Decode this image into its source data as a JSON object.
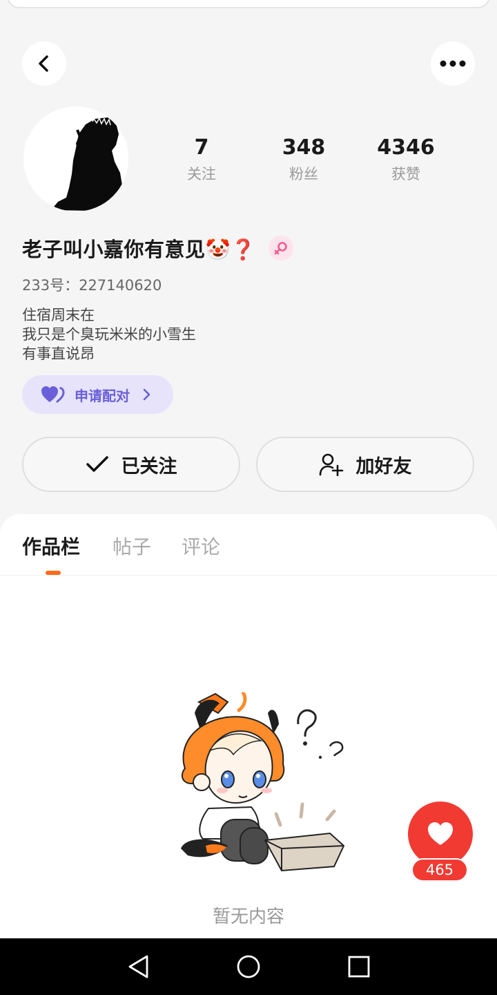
{
  "header": {
    "back_icon": "chevron-left-icon",
    "more_icon": "more-dots-icon"
  },
  "profile": {
    "stats": [
      {
        "value": "7",
        "label": "关注"
      },
      {
        "value": "348",
        "label": "粉丝"
      },
      {
        "value": "4346",
        "label": "获赞"
      }
    ],
    "name": "老子叫小嘉你有意见🤡❓",
    "gender_icon": "female-symbol-icon",
    "uid": "233号：227140620",
    "bio": [
      "住宿周末在",
      "我只是个臭玩米米的小雪生",
      "有事直说昂"
    ],
    "pair_button": {
      "label": "申请配对",
      "icon": "double-heart-icon",
      "color": "#6a5fd8"
    }
  },
  "actions": {
    "follow_label": "已关注",
    "friend_label": "加好友"
  },
  "tabs": [
    {
      "label": "作品栏",
      "active": true
    },
    {
      "label": "帖子",
      "active": false
    },
    {
      "label": "评论",
      "active": false
    }
  ],
  "empty_state": {
    "text": "暂无内容"
  },
  "like": {
    "count": "465",
    "color": "#f03a32"
  },
  "navbar": {
    "back": "triangle-back-icon",
    "home": "circle-home-icon",
    "recents": "square-recents-icon"
  },
  "colors": {
    "accent": "#ff6a1a",
    "pair_bg": "#e6e3fb"
  }
}
